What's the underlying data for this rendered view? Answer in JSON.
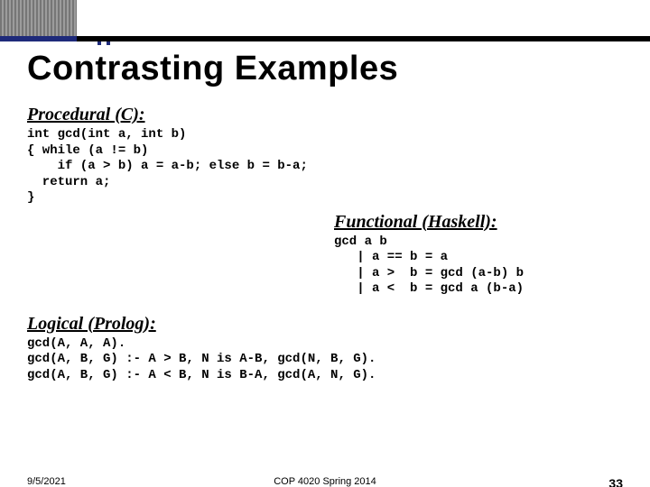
{
  "title": "Contrasting Examples",
  "procedural": {
    "label": "Procedural (C):",
    "code": "int gcd(int a, int b)\n{ while (a != b)\n    if (a > b) a = a-b; else b = b-a;\n  return a;\n}"
  },
  "functional": {
    "label": "Functional (Haskell):",
    "code": "gcd a b\n   | a == b = a\n   | a >  b = gcd (a-b) b\n   | a <  b = gcd a (b-a)"
  },
  "logical": {
    "label": "Logical (Prolog):",
    "code": "gcd(A, A, A).\ngcd(A, B, G) :- A > B, N is A-B, gcd(N, B, G).\ngcd(A, B, G) :- A < B, N is B-A, gcd(A, N, G)."
  },
  "footer": {
    "date": "9/5/2021",
    "course": "COP 4020 Spring 2014",
    "page": "33"
  }
}
